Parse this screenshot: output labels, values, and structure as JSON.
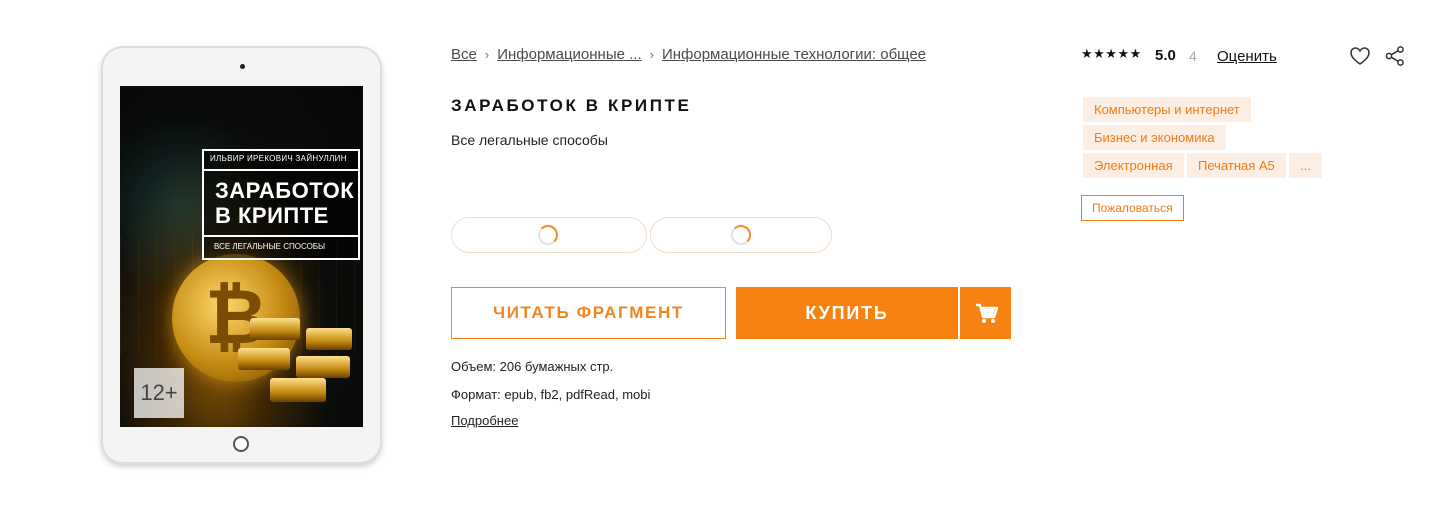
{
  "cover": {
    "author": "ИЛЬВИР ИРЕКОВИЧ ЗАЙНУЛЛИН",
    "title_line1": "ЗАРАБОТОК",
    "title_line2": "В КРИПТЕ",
    "subtitle": "ВСЕ ЛЕГАЛЬНЫЕ СПОСОБЫ",
    "age": "12+"
  },
  "breadcrumb": {
    "items": [
      "Все",
      "Информационные ...",
      "Информационные технологии: общее"
    ],
    "separator": "›"
  },
  "book": {
    "title": "ЗАРАБОТОК В КРИПТЕ",
    "subtitle": "Все легальные способы"
  },
  "actions": {
    "read_label": "ЧИТАТЬ ФРАГМЕНТ",
    "buy_label": "КУПИТЬ",
    "cart_icon": "cart-icon"
  },
  "details": {
    "volume": "Объем: 206 бумажных стр.",
    "format": "Формат: epub, fb2, pdfRead, mobi",
    "more_link": "Подробнее"
  },
  "rating": {
    "stars": "★★★★★",
    "value": "5.0",
    "count": "4",
    "rate_link": "Оценить"
  },
  "icons": {
    "favorite": "heart-icon",
    "share": "share-icon"
  },
  "tags": [
    "Компьютеры и интернет",
    "Бизнес и экономика",
    "Электронная",
    "Печатная A5",
    "..."
  ],
  "complain_label": "Пожаловаться",
  "colors": {
    "accent": "#f7820f",
    "tag_bg": "#fdeee3",
    "tag_text": "#f07c18"
  }
}
